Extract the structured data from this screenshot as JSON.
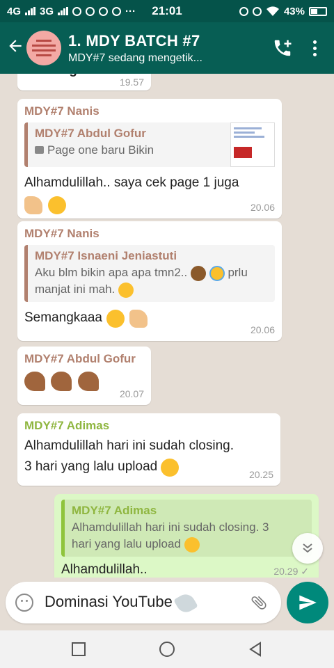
{
  "status_bar": {
    "network_1": "4G",
    "network_2": "3G",
    "time": "21:01",
    "battery": "43%",
    "icons": [
      "signal-icon",
      "whatsapp-icon",
      "telegram-icon",
      "chat-icon",
      "messenger-icon",
      "more-dots-icon",
      "alarm-icon",
      "mute-icon",
      "wifi-icon",
      "battery-icon"
    ]
  },
  "header": {
    "title": "1. MDY BATCH #7",
    "subtitle": "MDY#7 sedang mengetik..."
  },
  "messages": [
    {
      "id": "m0",
      "partial_text": "Cemungut",
      "time": "19.57"
    },
    {
      "id": "m1",
      "sender": "MDY#7 Nanis",
      "sender_color": "#b1806e",
      "quote": {
        "name": "MDY#7 Abdul Gofur",
        "text": "Page one baru Bikin",
        "has_image": true
      },
      "text": "Alhamdulillah.. saya cek page 1 juga",
      "time": "20.06"
    },
    {
      "id": "m2",
      "sender": "MDY#7 Nanis",
      "sender_color": "#b1806e",
      "quote": {
        "name": "MDY#7 Isnaeni Jeniastuti",
        "text_1": "Aku blm bikin apa apa tmn2..",
        "text_1b": "prlu",
        "text_2": "manjat ini mah."
      },
      "text": "Semangkaaa",
      "time": "20.06"
    },
    {
      "id": "m3",
      "sender": "MDY#7 Abdul Gofur",
      "sender_color": "#b1806e",
      "time": "20.07"
    },
    {
      "id": "m4",
      "sender": "MDY#7 Adimas",
      "sender_color": "#8fb640",
      "text_1": "Alhamdulillah hari ini sudah closing.",
      "text_2": "3 hari yang lalu upload",
      "time": "20.25"
    },
    {
      "id": "m5",
      "outgoing": true,
      "quote": {
        "name": "MDY#7 Adimas",
        "text_1": "Alhamdulillah hari ini sudah closing. 3",
        "text_2": "hari yang lalu upload"
      },
      "text": "Alhamdulillah..",
      "time": "20.29",
      "status": "sent"
    }
  ],
  "composer": {
    "value": "Dominasi YouTube"
  },
  "colors": {
    "app_bar": "#075e54",
    "status_bar": "#05534a",
    "send_button": "#00897b",
    "outgoing_bubble": "#dcf8c6",
    "chat_background": "#e5ddd5"
  }
}
